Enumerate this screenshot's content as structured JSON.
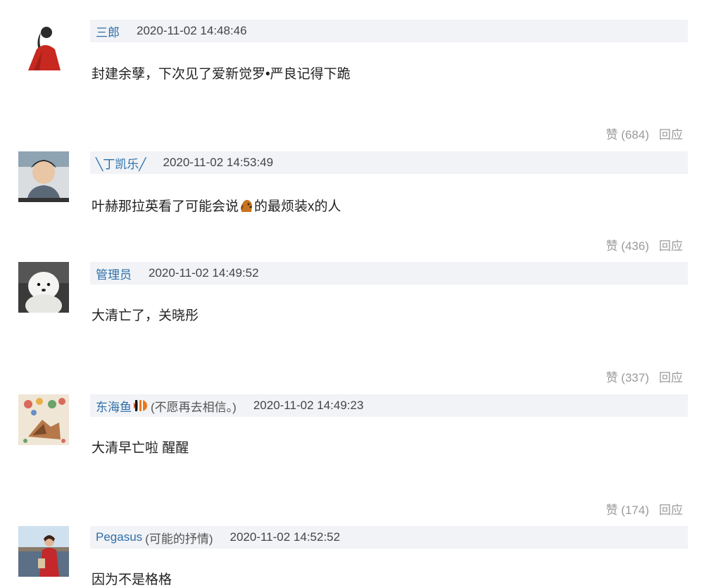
{
  "comments": [
    {
      "username": "三郎",
      "note": "",
      "timestamp": "2020-11-02 14:48:46",
      "text": "封建余孽，下次见了爱新觉罗•严良记得下跪",
      "like_label": "赞 (684)",
      "reply_label": "回应"
    },
    {
      "username": "╲丁凯乐╱",
      "note": "",
      "timestamp": "2020-11-02 14:53:49",
      "text_before": "叶赫那拉英看了可能会说",
      "text_after": "的最烦装x的人",
      "like_label": "赞 (436)",
      "reply_label": "回应"
    },
    {
      "username": "管理员",
      "note": "",
      "timestamp": "2020-11-02 14:49:52",
      "text": "大清亡了，关晓彤",
      "like_label": "赞 (337)",
      "reply_label": "回应"
    },
    {
      "username": "东海鱼",
      "note": "(不愿再去相信。)",
      "timestamp": "2020-11-02 14:49:23",
      "text": "大清早亡啦 醒醒",
      "like_label": "赞 (174)",
      "reply_label": "回应"
    },
    {
      "username": "Pegasus",
      "note": "(可能的抒情)",
      "timestamp": "2020-11-02 14:52:52",
      "text": "因为不是格格"
    }
  ],
  "colors": {
    "username": "#2f6fa8",
    "meta_bar_bg": "#f1f3f6",
    "muted": "#9a9a9a"
  },
  "icons": {
    "fish_badge": "fish-icon",
    "inline_emoji": "dog-emoji-icon"
  }
}
